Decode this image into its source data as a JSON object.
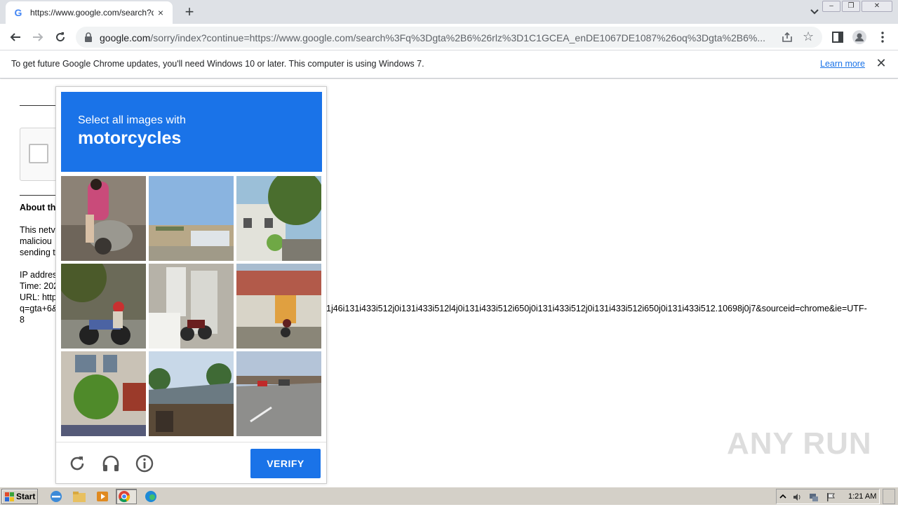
{
  "browser": {
    "tab": {
      "favicon": "G",
      "title": "https://www.google.com/search?q=",
      "close_label": "×"
    },
    "new_tab_label": "+",
    "window_buttons": {
      "minimize": "–",
      "restore": "❐",
      "close": "✕"
    },
    "address": {
      "host": "google.com",
      "path": "/sorry/index?continue=https://www.google.com/search%3Fq%3Dgta%2B6%26rlz%3D1C1GCEA_enDE1067DE1087%26oq%3Dgta%2B6%..."
    },
    "star_glyph": "☆"
  },
  "infobar": {
    "message": "To get future Google Chrome updates, you'll need Windows 10 or later. This computer is using Windows 7.",
    "link": "Learn more",
    "close": "✕"
  },
  "page": {
    "about_heading": "About th",
    "lines": [
      "This netv",
      "maliciou",
      "sending t",
      "IP addres",
      "Time: 202",
      "URL: http",
      "q=gta+6&",
      "8"
    ],
    "url_tail": "1j46i131i433i512j0i131i433i512l4j0i131i433i512i650j0i131i433i512j0i131i433i512i650j0i131i433i512.10698j0j7&sourceid=chrome&ie=UTF-"
  },
  "captcha": {
    "instruction": "Select all images with",
    "target": "motorcycles",
    "verify_label": "VERIFY",
    "icons": [
      "reload-icon",
      "audio-icon",
      "info-icon"
    ]
  },
  "taskbar": {
    "start_label": "Start",
    "clock": "1:21 AM"
  },
  "watermark": "ANY RUN",
  "colors": {
    "accent": "#1a73e8",
    "tabstrip": "#dee1e6",
    "taskbar": "#d4d0c8"
  }
}
